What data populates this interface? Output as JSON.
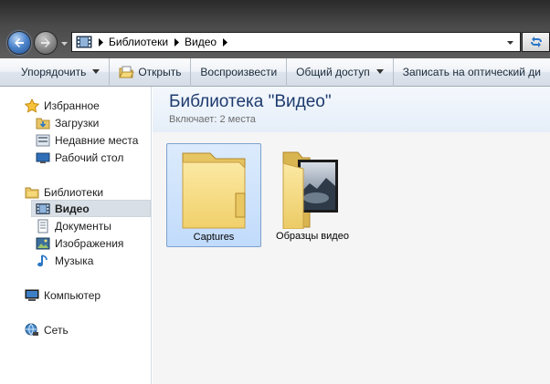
{
  "address": {
    "segments": [
      "Библиотеки",
      "Видео"
    ]
  },
  "icons": {
    "back": "back-arrow-icon",
    "forward": "forward-arrow-icon",
    "refresh": "refresh-icon",
    "folder": "folder-icon",
    "video_library": "video-library-icon"
  },
  "toolbar": {
    "organize_label": "Упорядочить",
    "open_label": "Открыть",
    "play_label": "Воспроизвести",
    "share_label": "Общий доступ",
    "burn_label": "Записать на оптический ди"
  },
  "nav": {
    "favorites": "Избранное",
    "downloads": "Загрузки",
    "recent": "Недавние места",
    "desktop": "Рабочий стол",
    "libraries": "Библиотеки",
    "video": "Видео",
    "documents": "Документы",
    "images": "Изображения",
    "music": "Музыка",
    "computer": "Компьютер",
    "network": "Сеть"
  },
  "library": {
    "title": "Библиотека \"Видео\"",
    "includes_label": "Включает:",
    "includes_value": "2 места"
  },
  "items": [
    {
      "name": "Captures",
      "selected": true
    },
    {
      "name": "Образцы видео",
      "selected": false
    }
  ],
  "colors": {
    "selection_bg": "#c1dbfc",
    "selection_border": "#7da2ce",
    "header_text": "#1e3b6e",
    "back_button": "#4f86cc"
  }
}
